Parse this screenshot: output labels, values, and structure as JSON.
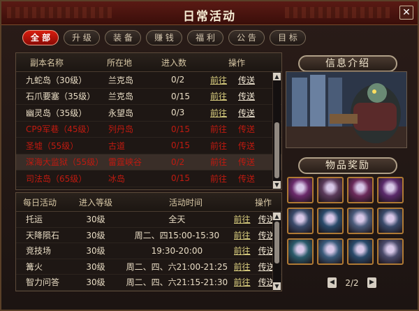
{
  "window": {
    "title": "日常活动",
    "close_label": "✕"
  },
  "tabs": [
    {
      "label": "全 部",
      "active": true
    },
    {
      "label": "升 级",
      "active": false
    },
    {
      "label": "装 备",
      "active": false
    },
    {
      "label": "赚 钱",
      "active": false
    },
    {
      "label": "福 利",
      "active": false
    },
    {
      "label": "公 告",
      "active": false
    },
    {
      "label": "目 标",
      "active": false
    }
  ],
  "dungeons": {
    "headers": {
      "name": "副本名称",
      "location": "所在地",
      "entries": "进入数",
      "action": "操作"
    },
    "action_go": "前往",
    "action_teleport": "传送",
    "rows": [
      {
        "name": "九蛇岛（30级）",
        "location": "兰克岛",
        "entries": "0/2",
        "locked": false
      },
      {
        "name": "石爪要塞（35级）",
        "location": "兰克岛",
        "entries": "0/15",
        "locked": false
      },
      {
        "name": "幽灵岛（35级）",
        "location": "永望岛",
        "entries": "0/3",
        "locked": false
      },
      {
        "name": "CP9军巷（45级）",
        "location": "列丹岛",
        "entries": "0/15",
        "locked": true
      },
      {
        "name": "圣墟（55级）",
        "location": "古道",
        "entries": "0/15",
        "locked": true
      },
      {
        "name": "深海大监狱（55级）",
        "location": "雷霆峡谷",
        "entries": "0/2",
        "locked": true,
        "selected": true
      },
      {
        "name": "司法岛（65级）",
        "location": "冰岛",
        "entries": "0/15",
        "locked": true
      }
    ]
  },
  "daily": {
    "headers": {
      "name": "每日活动",
      "level": "进入等级",
      "time": "活动时间",
      "action": "操作"
    },
    "action_go": "前往",
    "action_teleport": "传送",
    "rows": [
      {
        "name": "托运",
        "level": "30级",
        "time": "全天"
      },
      {
        "name": "天降陨石",
        "level": "30级",
        "time": "周二、四15:00-15:30"
      },
      {
        "name": "竞技场",
        "level": "30级",
        "time": "19:30-20:00"
      },
      {
        "name": "篝火",
        "level": "30级",
        "time": "周二、四、六21:00-21:25"
      },
      {
        "name": "智力问答",
        "level": "30级",
        "time": "周二、四、六21:15-21:30"
      }
    ]
  },
  "info": {
    "title": "信息介绍"
  },
  "rewards": {
    "title": "物品奖励",
    "items": [
      {
        "icon": "boots-icon",
        "color": "#6a2a6a"
      },
      {
        "icon": "sword-icon",
        "color": "#5a3a5a"
      },
      {
        "icon": "leg-armor-icon",
        "color": "#6a2a5a"
      },
      {
        "icon": "glove-icon",
        "color": "#5a2a6a"
      },
      {
        "icon": "gauntlet-icon",
        "color": "#3a4a6a"
      },
      {
        "icon": "blade-icon",
        "color": "#2a4a6a"
      },
      {
        "icon": "armor-icon",
        "color": "#4a5a7a"
      },
      {
        "icon": "pants-icon",
        "color": "#3a4a6a"
      },
      {
        "icon": "greaves-icon",
        "color": "#2a5a6a"
      },
      {
        "icon": "ring-icon",
        "color": "#3a5a7a"
      },
      {
        "icon": "gem-icon",
        "color": "#2a4a6a"
      },
      {
        "icon": "bracer-icon",
        "color": "#4a4a6a"
      }
    ],
    "page": "2/2"
  }
}
